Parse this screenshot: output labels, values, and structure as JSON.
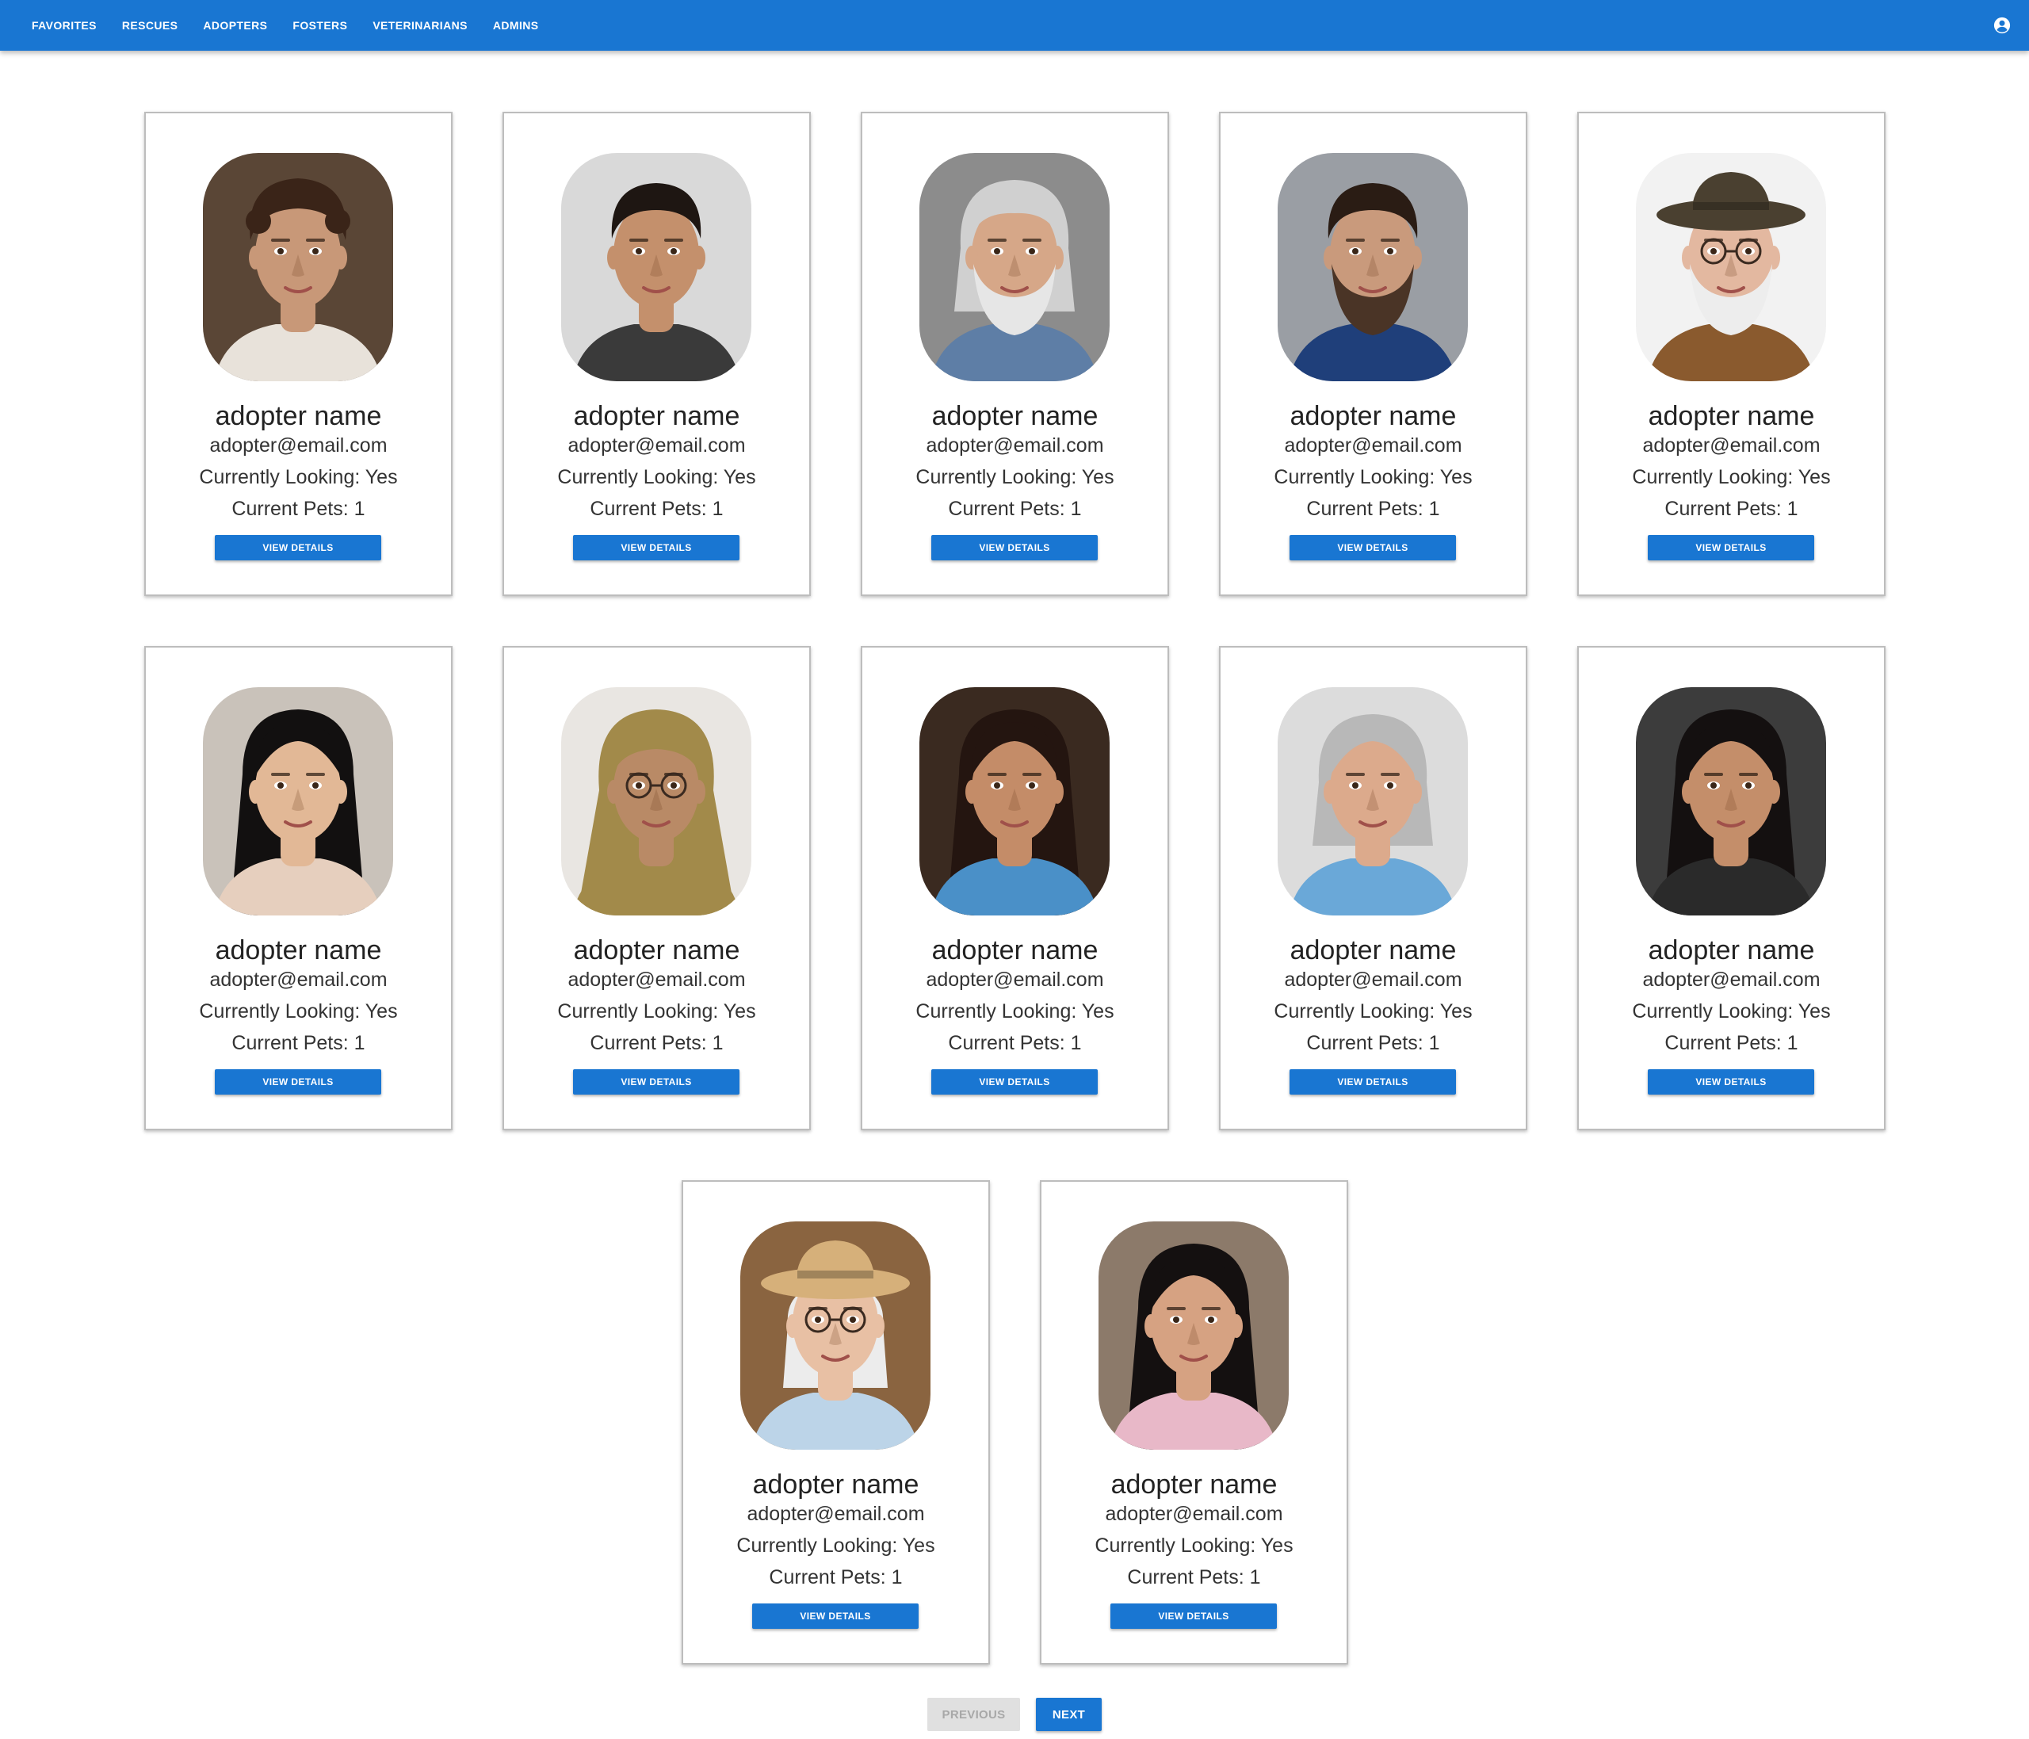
{
  "nav": {
    "items": [
      "FAVORITES",
      "RESCUES",
      "ADOPTERS",
      "FOSTERS",
      "VETERINARIANS",
      "ADMINS"
    ],
    "account_icon": "account-circle-icon"
  },
  "cards": [
    {
      "name": "adopter name",
      "email": "adopter@email.com",
      "looking": "Currently Looking: Yes",
      "pets": "Current Pets: 1",
      "button": "VIEW DETAILS"
    },
    {
      "name": "adopter name",
      "email": "adopter@email.com",
      "looking": "Currently Looking: Yes",
      "pets": "Current Pets: 1",
      "button": "VIEW DETAILS"
    },
    {
      "name": "adopter name",
      "email": "adopter@email.com",
      "looking": "Currently Looking: Yes",
      "pets": "Current Pets: 1",
      "button": "VIEW DETAILS"
    },
    {
      "name": "adopter name",
      "email": "adopter@email.com",
      "looking": "Currently Looking: Yes",
      "pets": "Current Pets: 1",
      "button": "VIEW DETAILS"
    },
    {
      "name": "adopter name",
      "email": "adopter@email.com",
      "looking": "Currently Looking: Yes",
      "pets": "Current Pets: 1",
      "button": "VIEW DETAILS"
    },
    {
      "name": "adopter name",
      "email": "adopter@email.com",
      "looking": "Currently Looking: Yes",
      "pets": "Current Pets: 1",
      "button": "VIEW DETAILS"
    },
    {
      "name": "adopter name",
      "email": "adopter@email.com",
      "looking": "Currently Looking: Yes",
      "pets": "Current Pets: 1",
      "button": "VIEW DETAILS"
    },
    {
      "name": "adopter name",
      "email": "adopter@email.com",
      "looking": "Currently Looking: Yes",
      "pets": "Current Pets: 1",
      "button": "VIEW DETAILS"
    },
    {
      "name": "adopter name",
      "email": "adopter@email.com",
      "looking": "Currently Looking: Yes",
      "pets": "Current Pets: 1",
      "button": "VIEW DETAILS"
    },
    {
      "name": "adopter name",
      "email": "adopter@email.com",
      "looking": "Currently Looking: Yes",
      "pets": "Current Pets: 1",
      "button": "VIEW DETAILS"
    },
    {
      "name": "adopter name",
      "email": "adopter@email.com",
      "looking": "Currently Looking: Yes",
      "pets": "Current Pets: 1",
      "button": "VIEW DETAILS"
    },
    {
      "name": "adopter name",
      "email": "adopter@email.com",
      "looking": "Currently Looking: Yes",
      "pets": "Current Pets: 1",
      "button": "VIEW DETAILS"
    }
  ],
  "pagination": {
    "previous_label": "PREVIOUS",
    "next_label": "NEXT",
    "previous_disabled": true
  },
  "colors": {
    "primary": "#1976d2",
    "disabled_bg": "#e0e0e0",
    "disabled_text": "#a8a8a8"
  }
}
